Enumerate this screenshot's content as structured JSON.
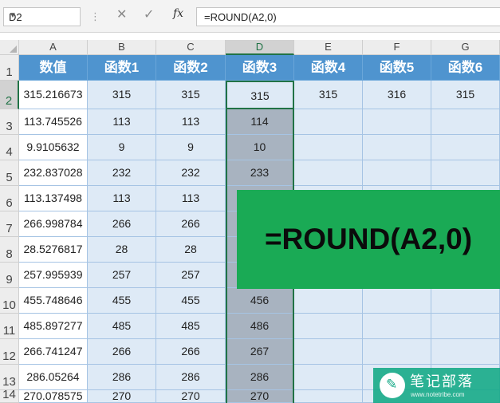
{
  "formula_bar": {
    "name_box": "D2",
    "cancel_icon": "✕",
    "enter_icon": "✓",
    "fx_label": "fx",
    "formula": "=ROUND(A2,0)"
  },
  "columns": [
    "A",
    "B",
    "C",
    "D",
    "E",
    "F",
    "G"
  ],
  "row_numbers": [
    "1",
    "2",
    "3",
    "4",
    "5",
    "6",
    "7",
    "8",
    "9",
    "10",
    "11",
    "12",
    "13",
    "14"
  ],
  "header_row": [
    "数值",
    "函数1",
    "函数2",
    "函数3",
    "函数4",
    "函数5",
    "函数6"
  ],
  "rows": [
    [
      "315.216673",
      "315",
      "315",
      "315",
      "315",
      "316",
      "315"
    ],
    [
      "113.745526",
      "113",
      "113",
      "114",
      "",
      "",
      ""
    ],
    [
      "9.9105632",
      "9",
      "9",
      "10",
      "",
      "",
      ""
    ],
    [
      "232.837028",
      "232",
      "232",
      "233",
      "",
      "",
      ""
    ],
    [
      "113.137498",
      "113",
      "113",
      "",
      "",
      "",
      ""
    ],
    [
      "266.998784",
      "266",
      "266",
      "",
      "",
      "",
      ""
    ],
    [
      "28.5276817",
      "28",
      "28",
      "",
      "",
      "",
      ""
    ],
    [
      "257.995939",
      "257",
      "257",
      "",
      "",
      "",
      ""
    ],
    [
      "455.748646",
      "455",
      "455",
      "456",
      "",
      "",
      ""
    ],
    [
      "485.897277",
      "485",
      "485",
      "486",
      "",
      "",
      ""
    ],
    [
      "266.741247",
      "266",
      "266",
      "267",
      "",
      "",
      ""
    ],
    [
      "286.05264",
      "286",
      "286",
      "286",
      "",
      "",
      ""
    ],
    [
      "270.078575",
      "270",
      "270",
      "270",
      "",
      "",
      ""
    ]
  ],
  "selected_cell": "D2",
  "banner_text": "=ROUND(A2,0)",
  "watermark": {
    "title": "笔记部落",
    "url": "www.notetribe.com",
    "icon": "pen-icon"
  },
  "colors": {
    "header_fill": "#4f94cf",
    "body_fill": "#deeaf6",
    "selection": "#217346",
    "banner": "#1aaa55"
  }
}
